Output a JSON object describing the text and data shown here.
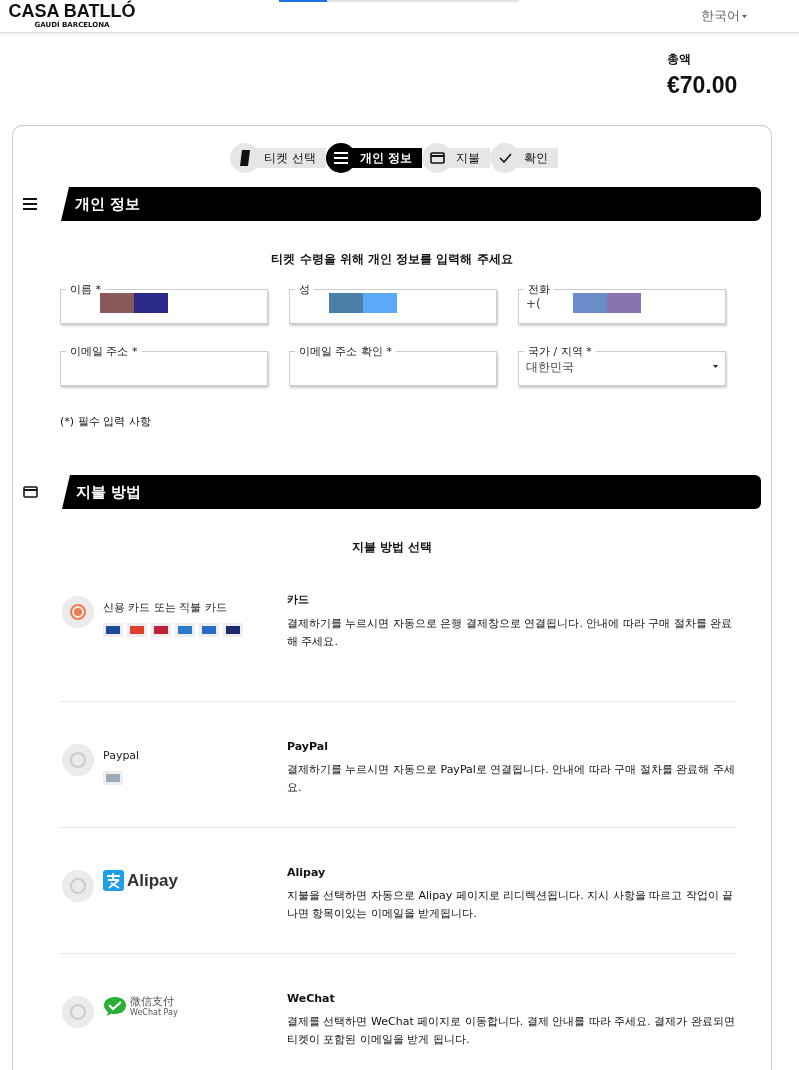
{
  "header": {
    "logo": "CASA BATLLÓ",
    "logo_sub": "GAUDÍ BARCELONA",
    "language": "한국어",
    "progress": {
      "level": 0.2
    }
  },
  "total": {
    "label": "총액",
    "amount": "€70.00"
  },
  "steps": [
    {
      "kind": "ticket",
      "label": "티켓 선택",
      "selected": false
    },
    {
      "kind": "menu",
      "label": "개인 정보",
      "selected": true
    },
    {
      "kind": "card",
      "label": "지불",
      "selected": false
    },
    {
      "kind": "check",
      "label": "확인",
      "selected": false
    }
  ],
  "personal": {
    "kind": "menu",
    "title": "개인 정보",
    "intro": "티켓 수령을 위해 개인 정보를 입력해 주세요",
    "fields": [
      {
        "kind": "text",
        "label": "이름 *",
        "redacted": true
      },
      {
        "kind": "text",
        "label": "성",
        "redacted": true
      },
      {
        "kind": "text",
        "label": "전화",
        "value": "+(",
        "redacted": true
      },
      {
        "kind": "text",
        "label": "이메일 주소 *",
        "redacted": false
      },
      {
        "kind": "text",
        "label": "이메일 주소 확인 *",
        "redacted": false
      },
      {
        "kind": "select",
        "label": "국가 / 지역 *",
        "value": "대한민국",
        "redacted": false
      }
    ],
    "note": "(*) 필수 입력 사항"
  },
  "payment": {
    "kind": "card",
    "title": "지불 방법",
    "intro": "지불 방법 선택",
    "methods": [
      {
        "kind": "cards",
        "label": "신용 카드 또는 직불 카드",
        "selected": true,
        "title": "카드",
        "description": "결제하기를 누르시면 자동으로 은행 결제창으로 연결됩니다. 안내에 따라 구매 절차를 완료해 주세요."
      },
      {
        "kind": "paypal",
        "label": "Paypal",
        "selected": false,
        "title": "PayPal",
        "description": "결제하기를 누르시면 자동으로 PayPal로 연결됩니다. 안내에 따라 구매 절차를 완료해 주세요."
      },
      {
        "kind": "alipay",
        "label": "Alipay",
        "selected": false,
        "title": "Alipay",
        "description": "지불을 선택하면 자동으로 Alipay 페이지로 리디렉션됩니다. 지시 사항을 따르고 작업이 끝나면 항목이있는 이메일을 받게됩니다."
      },
      {
        "kind": "wechat",
        "label": "微信支付",
        "sublabel": "WeChat Pay",
        "selected": false,
        "title": "WeChat",
        "description": "결제를 선택하면 WeChat 페이지로 이동합니다. 결제 안내를 따라 주세요. 결제가 완료되면 티켓이 포함된 이메일을 받게 됩니다."
      }
    ]
  }
}
